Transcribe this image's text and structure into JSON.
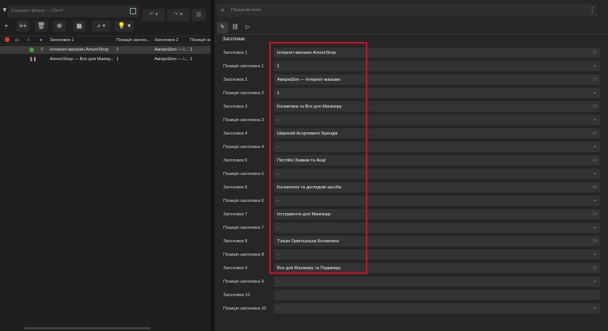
{
  "left": {
    "filter_placeholder": "Створити фільтр — Ctrl+F",
    "toolbar": {
      "undo": "↶",
      "redo": "↷",
      "add": "+",
      "insert": "≡+",
      "delete": "🗑",
      "zoom": "⊕",
      "search": "⌕",
      "bulb": "💡"
    },
    "columns": [
      "Заголовок 1",
      "Позиція заголо...",
      "Заголовок 2",
      "Позиція загол..."
    ],
    "rows": [
      {
        "title1": "Інтернет-магазин AmoreShop",
        "pos1": "1",
        "title2": "АмореШоп — І...",
        "pos2": "1",
        "selected": true,
        "status": "green"
      },
      {
        "title1": "AmoreShop — Все для Маніку...",
        "pos1": "1",
        "title2": "АмореШоп — І...",
        "pos2": "1",
        "selected": false,
        "status": "pause"
      }
    ]
  },
  "right": {
    "search_placeholder": "Пошукові поля",
    "section_title": "Заголовки",
    "fields": [
      {
        "label": "Заголовок 1",
        "value": "Інтернет-магазин AmoreShop",
        "count": "26",
        "type": "text"
      },
      {
        "label": "Позиція заголовка 1",
        "value": "1",
        "type": "select"
      },
      {
        "label": "Заголовок 2",
        "value": "АмореШоп — Інтернет-магазин",
        "count": "27",
        "type": "text"
      },
      {
        "label": "Позиція заголовка 2",
        "value": "1",
        "type": "select"
      },
      {
        "label": "Заголовок 3",
        "value": "Косметика та Все для Манікюру",
        "count": "29",
        "type": "text"
      },
      {
        "label": "Позиція заголовка 3",
        "value": "-",
        "type": "select"
      },
      {
        "label": "Заголовок 4",
        "value": "Широкий Асортимент Брендів",
        "count": "26",
        "type": "text"
      },
      {
        "label": "Позиція заголовка 4",
        "value": "-",
        "type": "select"
      },
      {
        "label": "Заголовок 5",
        "value": "Постійні Знижки та Акції",
        "count": "24",
        "type": "text"
      },
      {
        "label": "Позиція заголовка 5",
        "value": "-",
        "type": "select"
      },
      {
        "label": "Заголовок 6",
        "value": "Косметичні та доглядові засоби",
        "count": "30",
        "type": "text"
      },
      {
        "label": "Позиція заголовка 6",
        "value": "-",
        "type": "select"
      },
      {
        "label": "Заголовок 7",
        "value": "Інструменти для Манікюру",
        "count": "24",
        "type": "text"
      },
      {
        "label": "Позиція заголовка 7",
        "value": "-",
        "type": "select"
      },
      {
        "label": "Заголовок 8",
        "value": "Тільки Оригінальна Косметика",
        "count": "28",
        "type": "text"
      },
      {
        "label": "Позиція заголовка 8",
        "value": "-",
        "type": "select"
      },
      {
        "label": "Заголовок 9",
        "value": "Все для Манікюру та Педикюру",
        "count": "28",
        "type": "text"
      },
      {
        "label": "Позиція заголовка 9",
        "value": "-",
        "type": "select"
      },
      {
        "label": "Заголовок 10",
        "value": "",
        "count": "",
        "type": "text"
      },
      {
        "label": "Позиція заголовка 10",
        "value": "-",
        "type": "select"
      }
    ]
  },
  "colors": {
    "highlight": "#c8102e",
    "status_green": "#43a047",
    "status_red": "#e53935"
  }
}
